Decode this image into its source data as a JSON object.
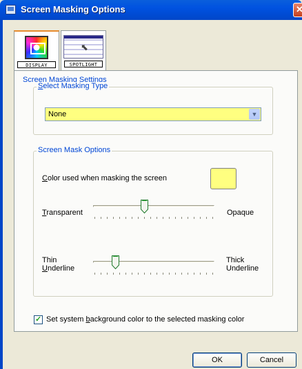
{
  "window": {
    "title": "Screen Masking Options"
  },
  "tabs": [
    {
      "caption": "DISPLAY",
      "icon": "display-icon",
      "active": true
    },
    {
      "caption": "SPOTLIGHT",
      "icon": "spotlight-icon",
      "active": false
    }
  ],
  "settings": {
    "group_title": "Screen Masking Settings",
    "masking_type": {
      "label_prefix": "S",
      "label_rest": "elect Masking Type",
      "selected": "None"
    },
    "options": {
      "group_title": "Screen Mask Options",
      "color_label_prefix": "C",
      "color_label_rest": "olor used when masking the screen",
      "mask_color": "#ffff80",
      "transparency": {
        "left_prefix": "T",
        "left_rest": "ransparent",
        "right": "Opaque",
        "value": 0.42
      },
      "underline": {
        "left_line1": "Thin",
        "left_line2_prefix": "U",
        "left_line2_rest": "nderline",
        "right_line1": "Thick",
        "right_line2": "Underline",
        "value": 0.18
      }
    },
    "system_color": {
      "label_pre": "Set system ",
      "label_key": "b",
      "label_post": "ackground color to the selected masking color",
      "checked": true
    }
  },
  "buttons": {
    "ok": "OK",
    "cancel": "Cancel"
  },
  "colors": {
    "title_bar": "#0052e0",
    "accent_text": "#0046d5",
    "highlight": "#ffff80"
  }
}
